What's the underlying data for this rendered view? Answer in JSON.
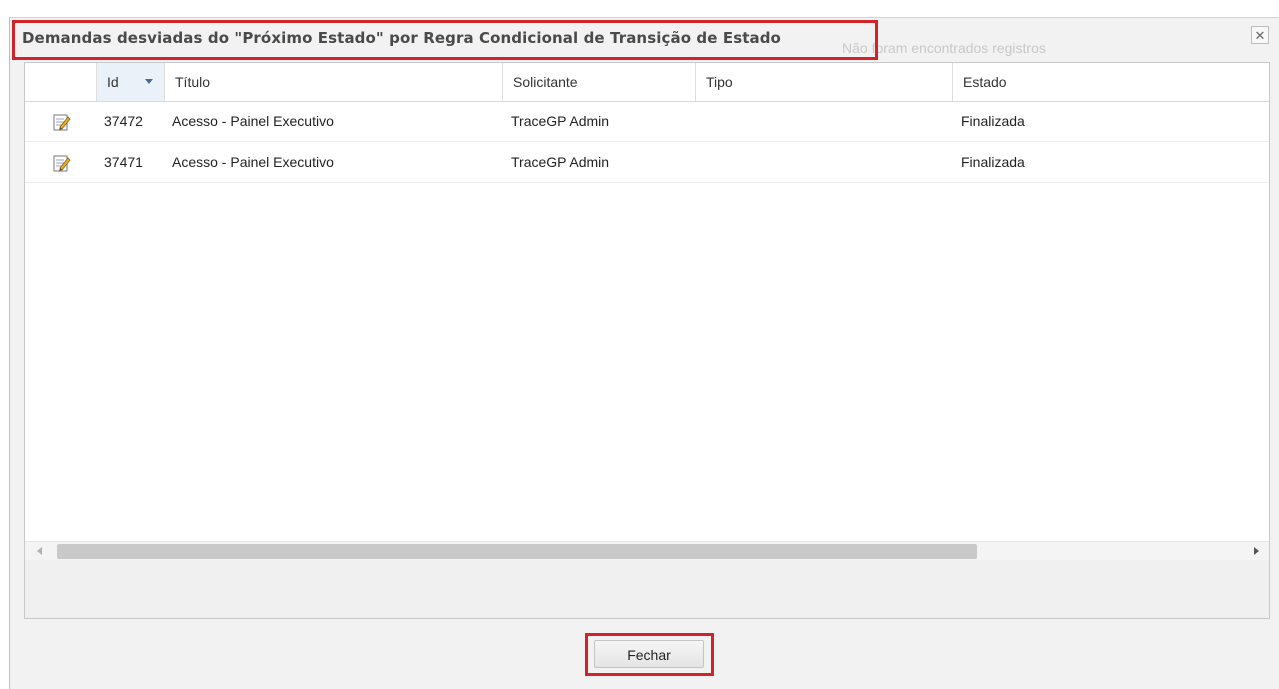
{
  "dialog": {
    "title": "Demandas desviadas do \"Próximo Estado\" por Regra Condicional de Transição de Estado",
    "background_message": "Não foram encontrados registros",
    "close_symbol": "✕"
  },
  "grid": {
    "columns": {
      "id": "Id",
      "titulo": "Título",
      "solicitante": "Solicitante",
      "tipo": "Tipo",
      "estado": "Estado"
    },
    "sorted_column": "id",
    "rows": [
      {
        "id": "37472",
        "titulo": "Acesso - Painel Executivo",
        "solicitante": "TraceGP Admin",
        "tipo": "",
        "estado": "Finalizada"
      },
      {
        "id": "37471",
        "titulo": "Acesso - Painel Executivo",
        "solicitante": "TraceGP Admin",
        "tipo": "",
        "estado": "Finalizada"
      }
    ],
    "row_icon": "edit-pencil-icon"
  },
  "footer": {
    "close_button_label": "Fechar"
  },
  "colors": {
    "highlight": "#d2232a",
    "title_text": "#4a4a4a",
    "sorted_header_bg": "#eaf1f9"
  }
}
